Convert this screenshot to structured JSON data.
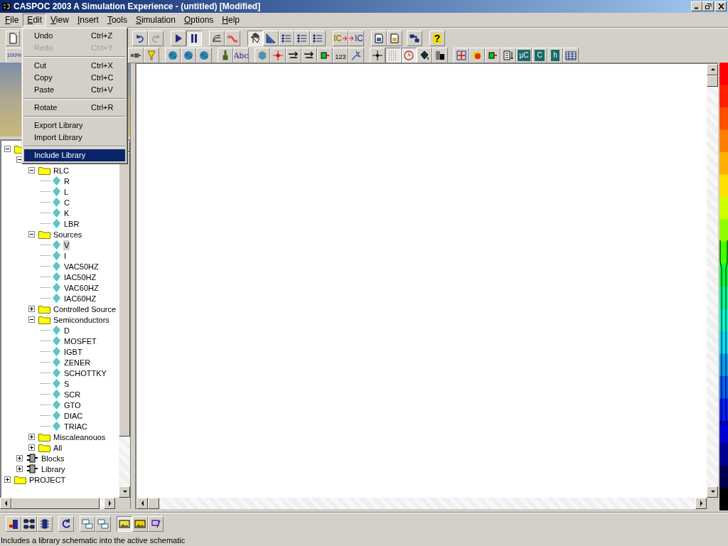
{
  "window": {
    "title": "CASPOC 2003 A Simulation Experience - (untitled) [Modified]"
  },
  "menu_bar": [
    {
      "label": "File",
      "selected": false
    },
    {
      "label": "Edit",
      "selected": true
    },
    {
      "label": "View",
      "selected": false
    },
    {
      "label": "Insert",
      "selected": false
    },
    {
      "label": "Tools",
      "selected": false
    },
    {
      "label": "Simulation",
      "selected": false
    },
    {
      "label": "Options",
      "selected": false
    },
    {
      "label": "Help",
      "selected": false
    }
  ],
  "edit_menu": [
    {
      "kind": "item",
      "label": "Undo",
      "shortcut": "Ctrl+Z",
      "disabled": false,
      "selected": false
    },
    {
      "kind": "item",
      "label": "Redo",
      "shortcut": "Ctrl+Y",
      "disabled": true,
      "selected": false
    },
    {
      "kind": "separator"
    },
    {
      "kind": "item",
      "label": "Cut",
      "shortcut": "Ctrl+X",
      "disabled": false,
      "selected": false
    },
    {
      "kind": "item",
      "label": "Copy",
      "shortcut": "Ctrl+C",
      "disabled": false,
      "selected": false
    },
    {
      "kind": "item",
      "label": "Paste",
      "shortcut": "Ctrl+V",
      "disabled": false,
      "selected": false
    },
    {
      "kind": "separator"
    },
    {
      "kind": "item",
      "label": "Rotate",
      "shortcut": "Ctrl+R",
      "disabled": false,
      "selected": false
    },
    {
      "kind": "separator"
    },
    {
      "kind": "item",
      "label": "Export Library",
      "disabled": false,
      "selected": false
    },
    {
      "kind": "item",
      "label": "Import Library",
      "disabled": false,
      "selected": false
    },
    {
      "kind": "separator"
    },
    {
      "kind": "item",
      "label": "Include Library",
      "disabled": false,
      "selected": true
    }
  ],
  "toolbar_top": [
    [
      {
        "kind": "page",
        "pressed": false
      }
    ],
    [
      {
        "kind": "undo",
        "pressed": false
      },
      {
        "kind": "redo",
        "pressed": false
      }
    ],
    [
      {
        "kind": "play",
        "pressed": false
      },
      {
        "kind": "pause",
        "pressed": true
      }
    ],
    [
      {
        "kind": "waveform",
        "pressed": false
      },
      {
        "kind": "signal",
        "pressed": false
      }
    ],
    [
      {
        "kind": "hand",
        "pressed": true
      },
      {
        "kind": "setsquare",
        "pressed": false
      },
      {
        "kind": "list",
        "pressed": false
      },
      {
        "kind": "list",
        "pressed": false
      },
      {
        "kind": "list",
        "pressed": false
      }
    ],
    [
      {
        "kind": "inject",
        "text": "IC",
        "pressed": false
      },
      {
        "kind": "eject",
        "text": "IC",
        "pressed": false
      }
    ],
    [
      {
        "kind": "scopedoc",
        "pressed": false
      },
      {
        "kind": "imagedoc",
        "pressed": false
      }
    ],
    [
      {
        "kind": "tree",
        "pressed": false
      }
    ],
    [
      {
        "kind": "help",
        "text": "?",
        "pressed": false
      }
    ]
  ],
  "toolbar_second": [
    [
      {
        "kind": "zoom",
        "text": "100%",
        "pressed": false
      }
    ],
    [
      {
        "kind": "plug",
        "pressed": false
      },
      {
        "kind": "funnel",
        "pressed": false
      }
    ],
    [
      {
        "kind": "globe",
        "pressed": false
      },
      {
        "kind": "globe",
        "pressed": false
      },
      {
        "kind": "globe",
        "pressed": false
      }
    ],
    [
      {
        "kind": "brush",
        "pressed": false
      },
      {
        "kind": "label",
        "text": "Abc",
        "pressed": false
      }
    ],
    [
      {
        "kind": "cube",
        "pressed": false
      },
      {
        "kind": "node",
        "pressed": false
      },
      {
        "kind": "arrow",
        "pressed": false
      },
      {
        "kind": "arrow",
        "pressed": false
      },
      {
        "kind": "block",
        "pressed": false
      },
      {
        "kind": "number",
        "text": "123",
        "pressed": false
      },
      {
        "kind": "wand",
        "pressed": false
      }
    ],
    [
      {
        "kind": "cross",
        "pressed": false
      },
      {
        "kind": "grid",
        "pressed": true
      },
      {
        "kind": "clock",
        "pressed": true
      },
      {
        "kind": "bucket",
        "pressed": false
      },
      {
        "kind": "gradient",
        "pressed": false
      }
    ],
    [
      {
        "kind": "fit",
        "pressed": false
      },
      {
        "kind": "burst",
        "pressed": false
      },
      {
        "kind": "rotate",
        "pressed": false
      },
      {
        "kind": "sort",
        "pressed": false
      },
      {
        "kind": "chip",
        "text": "µC",
        "pressed": false
      },
      {
        "kind": "chip",
        "text": "C",
        "pressed": false
      },
      {
        "kind": "chip",
        "text": "h",
        "pressed": false
      },
      {
        "kind": "table",
        "pressed": false
      }
    ]
  ],
  "tree": [
    {
      "kind": "folder",
      "expanded": true,
      "children": [
        {
          "kind": "group",
          "expanded": true,
          "children": [
            {
              "kind": "folder",
              "label": "RLC",
              "expanded": true,
              "children": [
                {
                  "kind": "part",
                  "label": "R",
                  "selected": false
                },
                {
                  "kind": "part",
                  "label": "L",
                  "selected": false
                },
                {
                  "kind": "part",
                  "label": "C",
                  "selected": false
                },
                {
                  "kind": "part",
                  "label": "K",
                  "selected": false
                },
                {
                  "kind": "part",
                  "label": "LBR",
                  "selected": false
                }
              ]
            },
            {
              "kind": "folder",
              "label": "Sources",
              "expanded": true,
              "children": [
                {
                  "kind": "part",
                  "label": "V",
                  "selected": true
                },
                {
                  "kind": "part",
                  "label": "I",
                  "selected": false
                },
                {
                  "kind": "part",
                  "label": "VAC50HZ",
                  "selected": false
                },
                {
                  "kind": "part",
                  "label": "IAC50HZ",
                  "selected": false
                },
                {
                  "kind": "part",
                  "label": "VAC60HZ",
                  "selected": false
                },
                {
                  "kind": "part",
                  "label": "IAC60HZ",
                  "selected": false
                }
              ]
            },
            {
              "kind": "folder",
              "label": "Controlled Source",
              "expanded": false
            },
            {
              "kind": "folder",
              "label": "Semiconductors",
              "expanded": true,
              "children": [
                {
                  "kind": "part",
                  "label": "D",
                  "selected": false
                },
                {
                  "kind": "part",
                  "label": "MOSFET",
                  "selected": false
                },
                {
                  "kind": "part",
                  "label": "IGBT",
                  "selected": false
                },
                {
                  "kind": "part",
                  "label": "ZENER",
                  "selected": false
                },
                {
                  "kind": "part",
                  "label": "SCHOTTKY",
                  "selected": false
                },
                {
                  "kind": "part",
                  "label": "S",
                  "selected": false
                },
                {
                  "kind": "part",
                  "label": "SCR",
                  "selected": false
                },
                {
                  "kind": "part",
                  "label": "GTO",
                  "selected": false
                },
                {
                  "kind": "part",
                  "label": "DIAC",
                  "selected": false
                },
                {
                  "kind": "part",
                  "label": "TRIAC",
                  "selected": false
                }
              ]
            },
            {
              "kind": "folder",
              "label": "Miscaleanouos",
              "expanded": false
            },
            {
              "kind": "folder",
              "label": "All",
              "expanded": false
            }
          ]
        },
        {
          "kind": "block",
          "label": "Blocks",
          "expanded": false
        },
        {
          "kind": "block",
          "label": "Library",
          "expanded": false
        }
      ]
    },
    {
      "kind": "folder",
      "label": "PROJECT",
      "expanded": false
    }
  ],
  "toolbar_bottom": [
    [
      {
        "kind": "blocks",
        "pressed": false
      },
      {
        "kind": "diagram",
        "pressed": false
      },
      {
        "kind": "chipb",
        "pressed": false
      }
    ],
    [
      {
        "kind": "refresh",
        "pressed": false
      }
    ],
    [
      {
        "kind": "windows",
        "pressed": false
      },
      {
        "kind": "windows",
        "pressed": false
      }
    ],
    [
      {
        "kind": "image",
        "pressed": true
      },
      {
        "kind": "imagestar",
        "pressed": false
      },
      {
        "kind": "paint",
        "pressed": false
      }
    ]
  ],
  "status_bar": {
    "text": "Includes a library schematic into the active schematic"
  }
}
